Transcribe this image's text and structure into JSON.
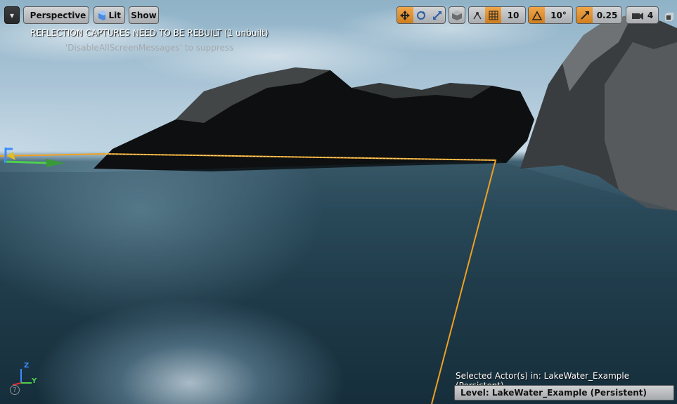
{
  "toolbar": {
    "dropdown_glyph": "▾",
    "perspective_label": "Perspective",
    "lit_label": "Lit",
    "show_label": "Show",
    "grid_snap_value": "10",
    "rotation_snap_value": "10°",
    "scale_snap_value": "0.25",
    "camera_speed_value": "4"
  },
  "messages": {
    "warning": "REFLECTION CAPTURES NEED TO BE REBUILT (1 unbuilt)",
    "suppress_hint": "'DisableAllScreenMessages' to suppress"
  },
  "status": {
    "selected_actor": "Selected Actor(s) in:  LakeWater_Example (Persistent)",
    "level": "Level:  LakeWater_Example (Persistent)"
  },
  "axis": {
    "z": "Z",
    "y": "Y",
    "help": "?"
  },
  "icons": {
    "translate": "move-arrows-icon",
    "rotate": "rotate-icon",
    "scale": "scale-icon",
    "surface": "surface-cube-icon",
    "surface_snap": "surface-snap-icon",
    "grid": "grid-icon",
    "angle": "angle-icon",
    "scale_snap": "scale-snap-icon",
    "camera": "camera-icon",
    "maximize": "maximize-icon"
  },
  "colors": {
    "selection_outline": "#f0a020",
    "toolbar_active": "#e0922f",
    "axis_x": "#e03030",
    "axis_y": "#4ed04e",
    "axis_z": "#3a8dff"
  }
}
